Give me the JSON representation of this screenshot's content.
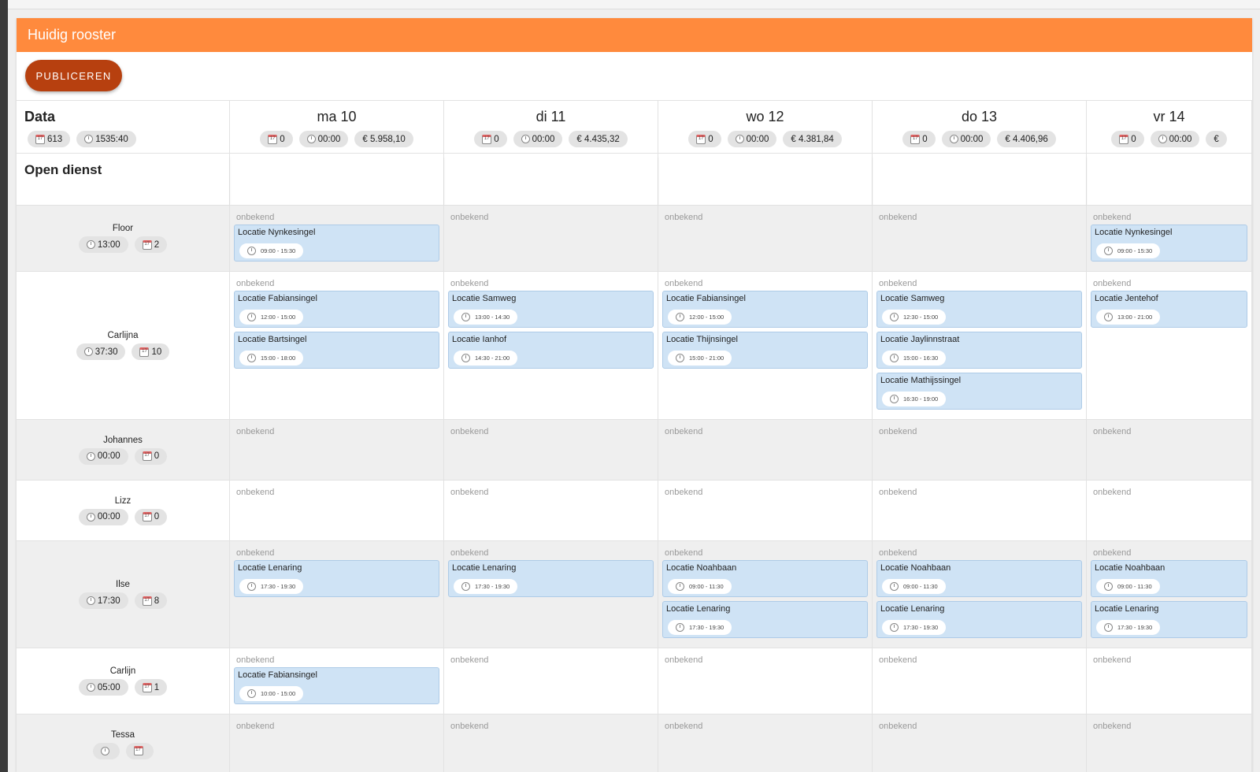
{
  "header": {
    "title": "Huidig rooster"
  },
  "toolbar": {
    "publish_label": "PUBLICEREN"
  },
  "summary": {
    "label": "Data",
    "shift_count": "613",
    "total_hours": "1535:40"
  },
  "days": [
    {
      "label": "ma 10",
      "count": "0",
      "hours": "00:00",
      "cost": "€ 5.958,10"
    },
    {
      "label": "di 11",
      "count": "0",
      "hours": "00:00",
      "cost": "€ 4.435,32"
    },
    {
      "label": "wo 12",
      "count": "0",
      "hours": "00:00",
      "cost": "€ 4.381,84"
    },
    {
      "label": "do 13",
      "count": "0",
      "hours": "00:00",
      "cost": "€ 4.406,96"
    },
    {
      "label": "vr 14",
      "count": "0",
      "hours": "00:00",
      "cost": "€"
    }
  ],
  "open_row": {
    "label": "Open dienst"
  },
  "unknown_label": "onbekend",
  "employees": [
    {
      "name": "Floor",
      "hours": "13:00",
      "count": "2",
      "days": [
        [
          {
            "location": "Locatie Nynkesingel",
            "time": "09:00 - 15:30"
          }
        ],
        [],
        [],
        [],
        [
          {
            "location": "Locatie Nynkesingel",
            "time": "09:00 - 15:30"
          }
        ]
      ]
    },
    {
      "name": "Carlijna",
      "hours": "37:30",
      "count": "10",
      "days": [
        [
          {
            "location": "Locatie Fabiansingel",
            "time": "12:00 - 15:00"
          },
          {
            "location": "Locatie Bartsingel",
            "time": "15:00 - 18:00"
          }
        ],
        [
          {
            "location": "Locatie Samweg",
            "time": "13:00 - 14:30"
          },
          {
            "location": "Locatie Ianhof",
            "time": "14:30 - 21:00"
          }
        ],
        [
          {
            "location": "Locatie Fabiansingel",
            "time": "12:00 - 15:00"
          },
          {
            "location": "Locatie Thijnsingel",
            "time": "15:00 - 21:00"
          }
        ],
        [
          {
            "location": "Locatie Samweg",
            "time": "12:30 - 15:00"
          },
          {
            "location": "Locatie Jaylinnstraat",
            "time": "15:00 - 16:30"
          },
          {
            "location": "Locatie Mathijssingel",
            "time": "16:30 - 19:00"
          }
        ],
        [
          {
            "location": "Locatie Jentehof",
            "time": "13:00 - 21:00"
          }
        ]
      ]
    },
    {
      "name": "Johannes",
      "hours": "00:00",
      "count": "0",
      "days": [
        [],
        [],
        [],
        [],
        []
      ]
    },
    {
      "name": "Lizz",
      "hours": "00:00",
      "count": "0",
      "days": [
        [],
        [],
        [],
        [],
        []
      ]
    },
    {
      "name": "Ilse",
      "hours": "17:30",
      "count": "8",
      "days": [
        [
          {
            "location": "Locatie Lenaring",
            "time": "17:30 - 19:30"
          }
        ],
        [
          {
            "location": "Locatie Lenaring",
            "time": "17:30 - 19:30"
          }
        ],
        [
          {
            "location": "Locatie Noahbaan",
            "time": "09:00 - 11:30"
          },
          {
            "location": "Locatie Lenaring",
            "time": "17:30 - 19:30"
          }
        ],
        [
          {
            "location": "Locatie Noahbaan",
            "time": "09:00 - 11:30"
          },
          {
            "location": "Locatie Lenaring",
            "time": "17:30 - 19:30"
          }
        ],
        [
          {
            "location": "Locatie Noahbaan",
            "time": "09:00 - 11:30"
          },
          {
            "location": "Locatie Lenaring",
            "time": "17:30 - 19:30"
          }
        ]
      ]
    },
    {
      "name": "Carlijn",
      "hours": "05:00",
      "count": "1",
      "days": [
        [
          {
            "location": "Locatie Fabiansingel",
            "time": "10:00 - 15:00"
          }
        ],
        [],
        [],
        [],
        []
      ]
    },
    {
      "name": "Tessa",
      "hours": "",
      "count": "",
      "days": [
        [],
        [],
        [],
        [],
        []
      ]
    }
  ]
}
